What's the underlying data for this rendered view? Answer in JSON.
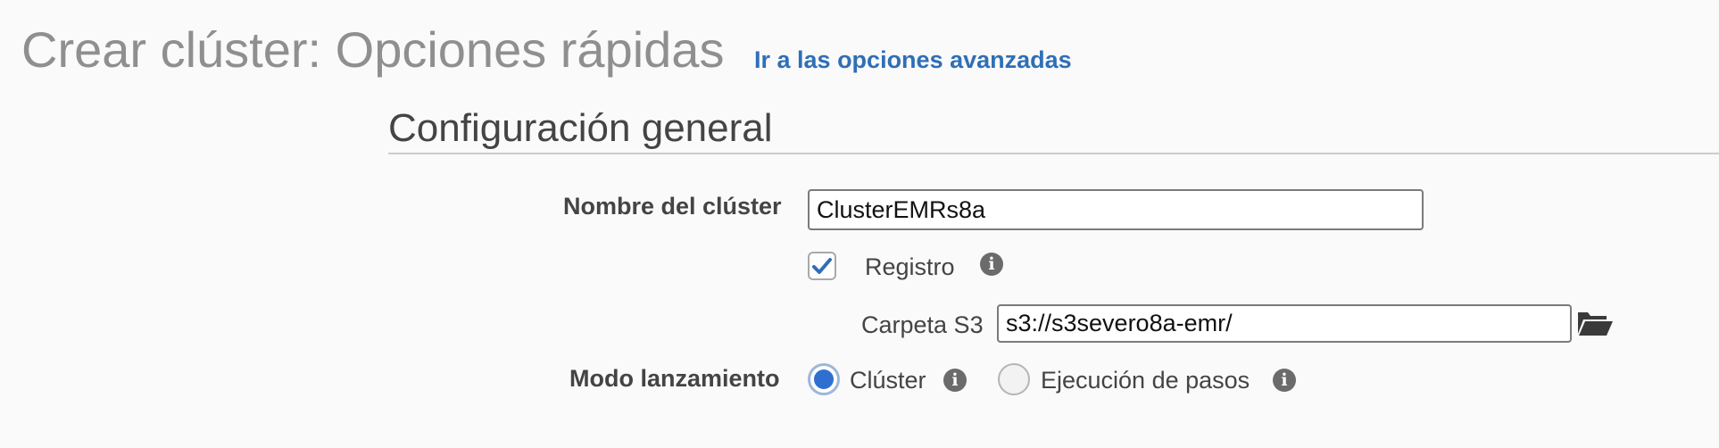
{
  "header": {
    "title": "Crear clúster: Opciones rápidas",
    "advanced_link": "Ir a las opciones avanzadas"
  },
  "general_config": {
    "section_title": "Configuración general",
    "cluster_name": {
      "label": "Nombre del clúster",
      "value": "ClusterEMRs8a"
    },
    "logging": {
      "label": "Registro",
      "checked": true
    },
    "s3_folder": {
      "label": "Carpeta S3",
      "value": "s3://s3severo8a-emr/"
    },
    "launch_mode": {
      "label": "Modo lanzamiento",
      "options": [
        {
          "label": "Clúster",
          "selected": true
        },
        {
          "label": "Ejecución de pasos",
          "selected": false
        }
      ]
    }
  },
  "icons": {
    "info": "info-icon",
    "folder": "folder-open-icon",
    "check": "checkmark-icon"
  },
  "colors": {
    "link": "#2f6fb6",
    "radio_selected": "#2f6fd0",
    "title_gray": "#8f8f8f"
  }
}
